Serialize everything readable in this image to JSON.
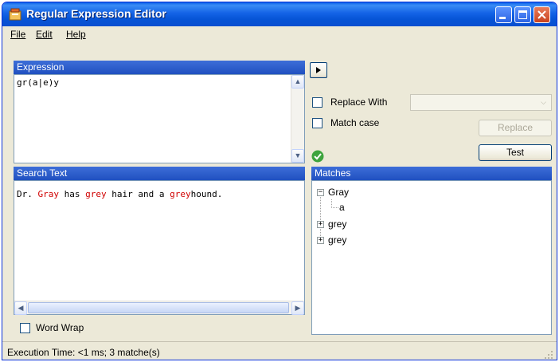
{
  "window": {
    "title": "Regular Expression Editor"
  },
  "menu": {
    "file": "File",
    "edit": "Edit",
    "help": "Help"
  },
  "expression": {
    "header": "Expression",
    "value": "gr(a|e)y"
  },
  "search": {
    "header": "Search Text",
    "segments": [
      {
        "text": "Dr. ",
        "match": false
      },
      {
        "text": "Gray",
        "match": true
      },
      {
        "text": " has ",
        "match": false
      },
      {
        "text": "grey",
        "match": true
      },
      {
        "text": " hair and a ",
        "match": false
      },
      {
        "text": "grey",
        "match": true
      },
      {
        "text": "hound.",
        "match": false
      }
    ]
  },
  "options": {
    "replace_with": "Replace With",
    "match_case": "Match case",
    "replace_button": "Replace",
    "test_button": "Test",
    "word_wrap": "Word Wrap"
  },
  "matches": {
    "header": "Matches",
    "items": [
      {
        "label": "Gray",
        "expanded": true,
        "children": [
          "a"
        ]
      },
      {
        "label": "grey",
        "expanded": false
      },
      {
        "label": "grey",
        "expanded": false
      }
    ]
  },
  "status": {
    "text": "Execution Time: <1 ms; 3 matche(s)"
  },
  "colors": {
    "titlebar": "#0a5fe8",
    "panel_header": "#2c5bc8",
    "match_highlight": "#d00000",
    "valid_icon": "#3ea43e"
  }
}
